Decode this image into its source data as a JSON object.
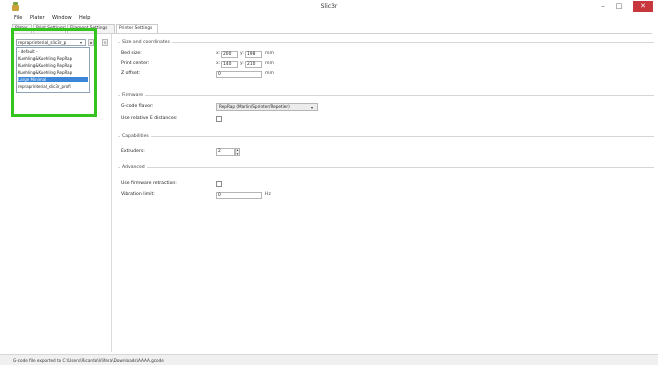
{
  "window": {
    "title": "Slic3r",
    "minimize": "–",
    "maximize": "□",
    "close": "✕"
  },
  "menu": [
    "File",
    "Plater",
    "Window",
    "Help"
  ],
  "tabs": [
    "Plater",
    "Print Settings",
    "Filament Settings",
    "Printer Settings"
  ],
  "preset": {
    "selected": "repraprinterial_slic3r_p",
    "options": [
      "- default -",
      "Kuehling&Kuehling RepRap",
      "Kuehling&Kuehling RepRap",
      "Kuehling&Kuehling RepRap",
      "Large Minimal",
      "repraprinterial_slic3r_profi"
    ]
  },
  "bed": {
    "section": "Size and coordinates",
    "bed_size_label": "Bed size:",
    "bed_x": "200",
    "bed_y": "198",
    "print_center_label": "Print center:",
    "center_x": "140",
    "center_y": "210",
    "z_offset_label": "Z offset:",
    "z_offset": "0",
    "unit_mm": "mm",
    "axis_x": "x:",
    "axis_y": "y:"
  },
  "firmware": {
    "section": "Firmware",
    "gcode_flavor_label": "G-code flavor:",
    "gcode_flavor": "RepRap (Marlin/Sprinter/Repetier)",
    "relative_e_label": "Use relative E distances:"
  },
  "capabilities": {
    "section": "Capabilities",
    "extruders_label": "Extruders:",
    "extruders": "2"
  },
  "advanced": {
    "section": "Advanced",
    "firmware_retraction_label": "Use firmware retraction:",
    "vibration_limit_label": "Vibration limit:",
    "vibration_limit": "0",
    "unit_hz": "Hz"
  },
  "status": {
    "text": "G-code file exported to C:\\Users\\Ricardo\\Vlifera\\Downloads\\AAAA.gcode"
  },
  "colors": {
    "highlight": "#35c41f",
    "selection": "#3b86d8",
    "close": "#c8373b"
  }
}
